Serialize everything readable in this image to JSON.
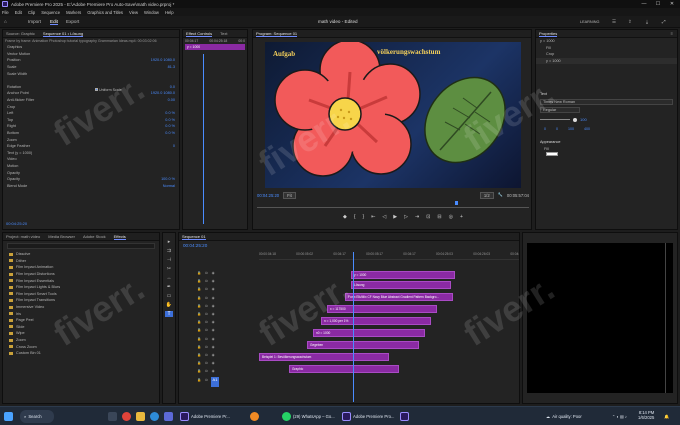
{
  "window": {
    "title": "Adobe Premiere Pro 2025 - E:\\Adobe Premiere Pro Auto-Save\\math video.prproj *",
    "min": "—",
    "max": "☐",
    "close": "✕"
  },
  "menu": [
    "File",
    "Edit",
    "Clip",
    "Sequence",
    "Markers",
    "Graphics and Titles",
    "View",
    "Window",
    "Help"
  ],
  "workspace": {
    "tabs": [
      "Import",
      "Edit",
      "Export"
    ],
    "center_title": "math video - Edited",
    "learning": "LEARNING"
  },
  "effect_controls": {
    "tabs": [
      "Source: Graphic",
      "Sequence 01 • Lösung"
    ],
    "header": "Frame by frame: Animation Photoshop tutorial typography Grammarian Ideas.mp4: 00:03:02:06",
    "rows": [
      {
        "label": "Graphics",
        "val": ""
      },
      {
        "label": "Vector Motion",
        "val": ""
      },
      {
        "label": "Position",
        "val": "1920.0   1080.0"
      },
      {
        "label": "Scale",
        "val": "81.3"
      },
      {
        "label": "Scale Width",
        "val": ""
      },
      {
        "label": "",
        "val": ""
      },
      {
        "label": "Rotation",
        "val": "0.0"
      },
      {
        "label": "Anchor Point",
        "val": "1920.0  1080.0"
      },
      {
        "label": "Anti-flicker Filter",
        "val": "0.00"
      },
      {
        "label": "Crop",
        "val": ""
      },
      {
        "label": "Left",
        "val": "0.0 %"
      },
      {
        "label": "Top",
        "val": "0.0 %"
      },
      {
        "label": "Right",
        "val": "0.0 %"
      },
      {
        "label": "Bottom",
        "val": "0.0 %"
      },
      {
        "label": "Zoom",
        "val": ""
      },
      {
        "label": "Edge Feather",
        "val": "0"
      },
      {
        "label": "Text (y = 1000)",
        "val": ""
      },
      {
        "label": "Video",
        "val": ""
      },
      {
        "label": "Motion",
        "val": ""
      },
      {
        "label": "Opacity",
        "val": ""
      },
      {
        "label": "Opacity",
        "val": "100.0 %"
      },
      {
        "label": "Blend Mode",
        "val": "Normal"
      }
    ],
    "uniform_scale": "Uniform Scale",
    "timecode": "00:04:25:20"
  },
  "ec_timeline": {
    "tabs": [
      "Effect Controls",
      "Text"
    ],
    "times": [
      "00:04:17",
      "00:04:25:18",
      "00:0"
    ],
    "clip_label": "y = 1000"
  },
  "program": {
    "title": "Program: Sequence 01",
    "overlay_text_left": "Aufgab",
    "overlay_text_right": "völkerungswachstum",
    "timecode_left": "00:04:25:20",
    "fit": "Fit",
    "scale": "1/2",
    "timecode_right": "00:05:57:04"
  },
  "properties": {
    "title": "Properties",
    "rows": [
      "y = 1000",
      "Fill",
      "Crop",
      "y = 1000"
    ],
    "text_section": "Text",
    "font": "Times New Roman",
    "style": "Regular",
    "size": "100",
    "appearance_section": "Appearance",
    "fill_label": "Fill",
    "values": [
      "0",
      "0",
      "100",
      "400"
    ]
  },
  "project": {
    "tabs": [
      "Project: math video",
      "Media Browser",
      "Adobe Stock",
      "Effects"
    ],
    "items": [
      "Dissolve",
      "Dither",
      "Film Impact Animation",
      "Film Impact Distortions",
      "Film Impact Essentials",
      "Film Impact Lights & Blurs",
      "Film Impact Smart Tools",
      "Film Impact Transitions",
      "Immersive Video",
      "Iris",
      "Page Peel",
      "Slide",
      "Wipe",
      "Zoom",
      "Cross Zoom",
      "Custom Bin 01"
    ]
  },
  "timeline": {
    "title": "Sequence 01",
    "timecode": "00:04:25:20",
    "ruler": [
      "00:00:04:18",
      "00:00:05:02",
      "00:04:17",
      "00:00:05:17",
      "00:04:17",
      "00:04:25:03",
      "00:04:26:03",
      "00:04:1"
    ],
    "clips": [
      {
        "label": "y = 1000"
      },
      {
        "label": "Lösung"
      },
      {
        "label": "Form Elk/Mix CF Navy Blue Abstract Gradient Pattern Backgro..."
      },
      {
        "label": "x = 117500"
      },
      {
        "label": "n = 1,000 per 1%"
      },
      {
        "label": "n0 = 1000"
      },
      {
        "label": "Gegeben"
      },
      {
        "label": "Beispiel 1: Bevölkerungswachstum"
      },
      {
        "label": "Graphic"
      }
    ]
  },
  "watermark": "fiverr.",
  "taskbar": {
    "search": "Search",
    "apps": [
      "Adobe Premiere Pr...",
      "(29) WhatsApp – Go...",
      "Adobe Premiere Pro..."
    ],
    "weather": "Air quality: Poor",
    "time": "8:14 PM",
    "date": "1/6/2025",
    "colors": {
      "accent": "#4a8cff",
      "clip": "#8a2aa3",
      "flower_petal": "#f25a5a",
      "flower_center": "#f7d54a",
      "leaf": "#5d8e41"
    }
  }
}
